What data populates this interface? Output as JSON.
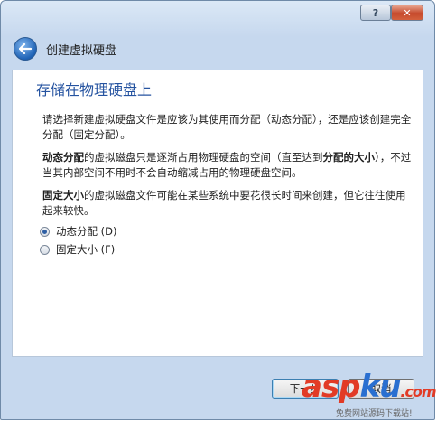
{
  "window": {
    "help_label": "?",
    "close_label": "✕"
  },
  "header": {
    "title": "创建虚拟硬盘"
  },
  "content": {
    "heading": "存储在物理硬盘上",
    "paragraph1": "请选择新建虚拟硬盘文件是应该为其使用而分配（动态分配），还是应该创建完全分配（固定分配）。",
    "paragraph2": {
      "bold_start": "动态分配",
      "text_mid": "的虚拟磁盘只是逐渐占用物理硬盘的空间（直至达到",
      "bold_mid": "分配的大小",
      "text_end": "），不过当其内部空间不用时不会自动缩减占用的物理硬盘空间。"
    },
    "paragraph3": {
      "bold_start": "固定大小",
      "text_end": "的虚拟磁盘文件可能在某些系统中要花很长时间来创建，但它往往使用起来较快。"
    },
    "options": [
      {
        "label": "动态分配 (D)",
        "selected": true
      },
      {
        "label": "固定大小 (F)",
        "selected": false
      }
    ]
  },
  "footer": {
    "next_label": "下一步",
    "cancel_label": "取消"
  },
  "watermark": {
    "brand_a": "asp",
    "brand_b": "ku",
    "brand_c": ".com",
    "subtitle": "免费网站源码下载站!"
  },
  "colors": {
    "heading": "#2553a0",
    "back_button": "#1f63b6",
    "close_button": "#c64a2c"
  }
}
